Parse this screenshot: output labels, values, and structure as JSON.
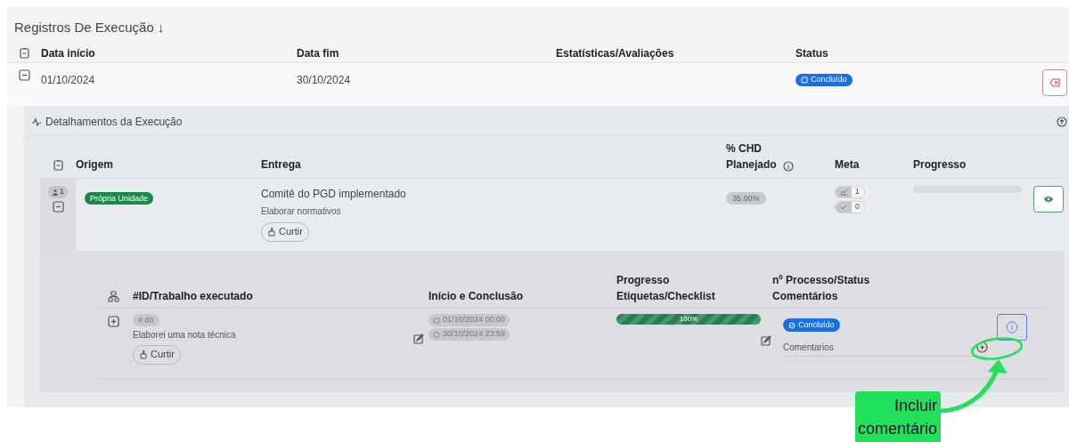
{
  "title": "Registros De Execução ↓",
  "table": {
    "columns": [
      "Data início",
      "Data fim",
      "Estatísticas/Avaliações",
      "Status"
    ],
    "rows": [
      {
        "data_inicio": "01/10/2024",
        "data_fim": "30/10/2024",
        "status": "Concluído",
        "expanded": true,
        "details": {
          "title": "Detalhamentos da Execução",
          "columns": [
            "Origem",
            "Entrega",
            "% CHD Planejado",
            "Meta",
            "Progresso"
          ],
          "rows": [
            {
              "count": "1",
              "expanded": true,
              "origem": "Própria Unidade",
              "entrega": "Comitê do PGD implementado",
              "descricao": "Elaborar normativos",
              "like": "Curtir",
              "chd": "35.00%",
              "meta_planejada": "1",
              "meta_realizada": "0",
              "progress": {
                "level": 0
              },
              "works": {
                "columns": [
                  "#ID/Trabalho executado",
                  "Início e Conclusão",
                  "Progresso Etiquetas/Checklist",
                  "nº Processo/Status Comentários"
                ],
                "rows": [
                  {
                    "expanded": false,
                    "id": "# 80",
                    "text": "Elaborei uma nota técnica",
                    "like": "Curtir",
                    "inicio": "01/10/2024 00:00",
                    "fim": "30/10/2024 23:59",
                    "progress": {
                      "level": 1
                    },
                    "progress_label": "100%",
                    "status": "Concluído",
                    "comments": "Comentarios"
                  }
                ]
              }
            }
          ]
        }
      }
    ]
  },
  "annotation": {
    "text": "Incluir comentário"
  }
}
